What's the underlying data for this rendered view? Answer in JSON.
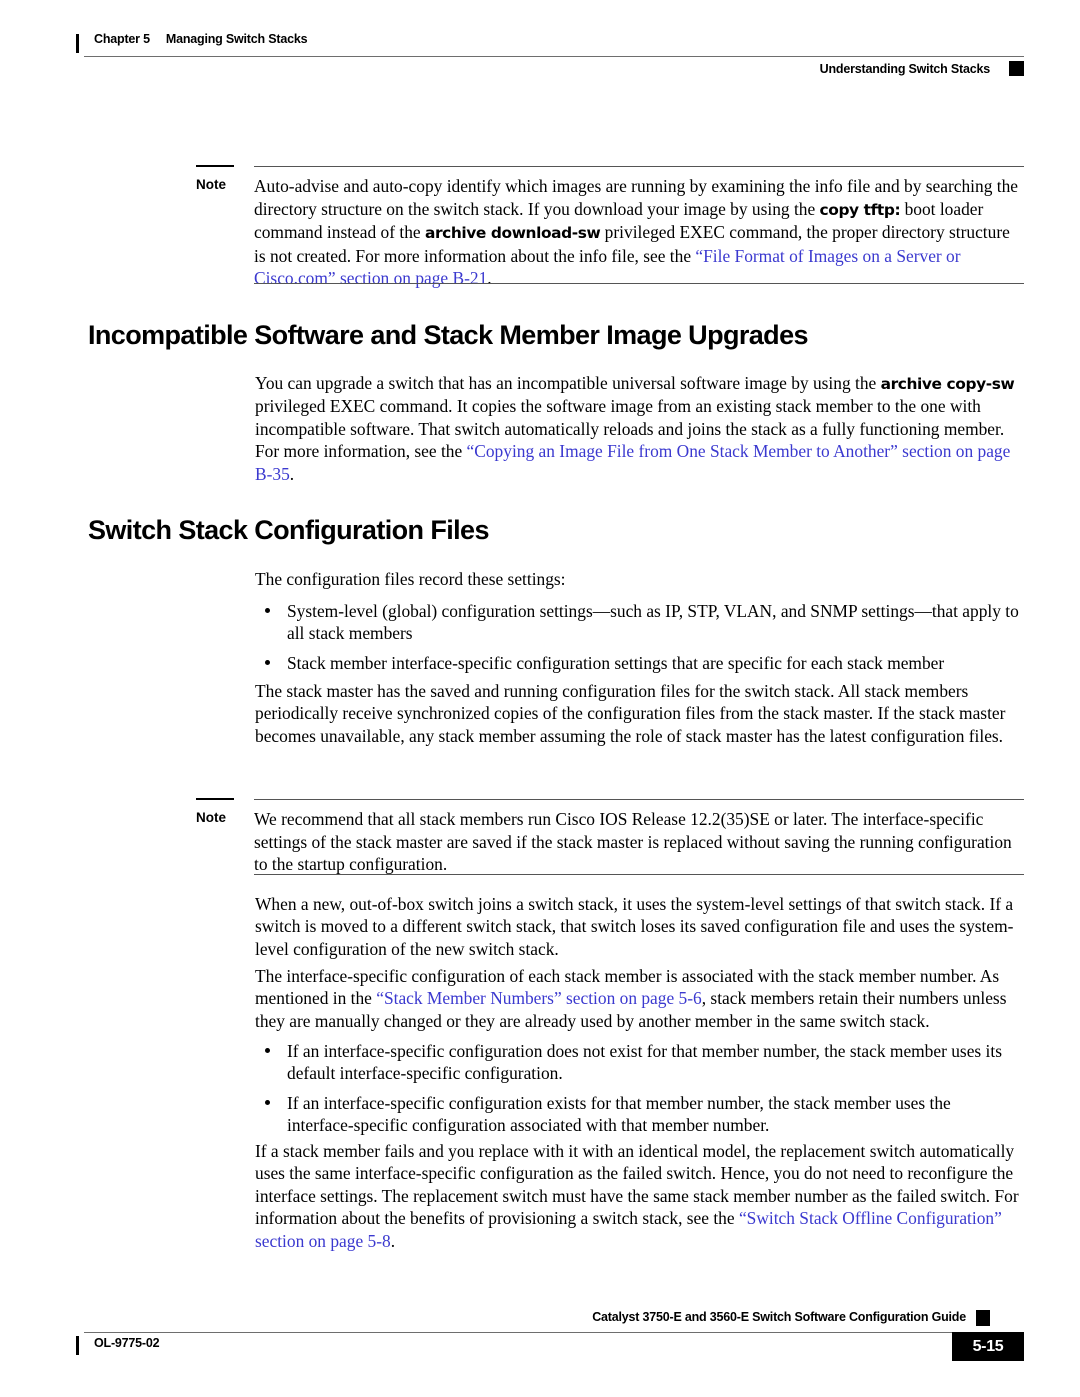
{
  "header": {
    "chapter_number": "Chapter 5",
    "chapter_title": "Managing Switch Stacks",
    "section_title": "Understanding Switch Stacks"
  },
  "footer": {
    "doc_id": "OL-9775-02",
    "guide_title": "Catalyst 3750-E and 3560-E Switch Software Configuration Guide",
    "page_number": "5-15"
  },
  "colors": {
    "link": "#3b39cf",
    "rule": "#6e6e6e",
    "text": "#000000"
  },
  "notes": {
    "note_label": "Note",
    "note1": {
      "t1": "Auto-advise and auto-copy identify which images are running by examining the info file and by searching the directory structure on the switch stack. If you download your image by using the ",
      "cmd1": "copy tftp:",
      "t2": " boot loader command instead of the ",
      "cmd2": "archive download-sw",
      "t3": " privileged EXEC command, the proper directory structure is not created. For more information about the info file, see the ",
      "link": "“File Format of Images on a Server or Cisco.com” section on page B-21",
      "t4": "."
    },
    "note2": {
      "t1": "We recommend that all stack members run Cisco IOS Release 12.2(35)SE or later. The interface-specific settings of the stack master are saved if the stack master is replaced without saving the running configuration to the startup configuration."
    }
  },
  "sections": {
    "heading1": "Incompatible Software and Stack Member Image Upgrades",
    "heading2": "Switch Stack Configuration Files"
  },
  "paragraphs": {
    "p1": {
      "t1": "You can upgrade a switch that has an incompatible universal software image by using the ",
      "cmd1": "archive copy-sw",
      "t2": " privileged EXEC command. It copies the software image from an existing stack member to the one with incompatible software. That switch automatically reloads and joins the stack as a fully functioning member. For more information, see the ",
      "link": "“Copying an Image File from One Stack Member to Another” section on page B-35",
      "t3": "."
    },
    "p2": "The configuration files record these settings:",
    "p3": "The stack master has the saved and running configuration files for the switch stack. All stack members periodically receive synchronized copies of the configuration files from the stack master. If the stack master becomes unavailable, any stack member assuming the role of stack master has the latest configuration files.",
    "p4": "When a new, out-of-box switch joins a switch stack, it uses the system-level settings of that switch stack. If a switch is moved to a different switch stack, that switch loses its saved configuration file and uses the system-level configuration of the new switch stack.",
    "p5": {
      "t1": "The interface-specific configuration of each stack member is associated with the stack member number. As mentioned in the ",
      "link": "“Stack Member Numbers” section on page 5-6",
      "t2": ", stack members retain their numbers unless they are manually changed or they are already used by another member in the same switch stack."
    },
    "p6": {
      "t1": "If a stack member fails and you replace with it with an identical model, the replacement switch automatically uses the same interface-specific configuration as the failed switch. Hence, you do not need to reconfigure the interface settings. The replacement switch must have the same stack member number as the failed switch. For information about the benefits of provisioning a switch stack, see the ",
      "link": "“Switch Stack Offline Configuration” section on page 5-8",
      "t2": "."
    }
  },
  "bullets": {
    "list1": [
      "System-level (global) configuration settings—such as IP, STP, VLAN, and SNMP settings—that apply to all stack members",
      "Stack member interface-specific configuration settings that are specific for each stack member"
    ],
    "list2": [
      "If an interface-specific configuration does not exist for that member number, the stack member uses its default interface-specific configuration.",
      "If an interface-specific configuration exists for that member number, the stack member uses the interface-specific configuration associated with that member number."
    ]
  }
}
